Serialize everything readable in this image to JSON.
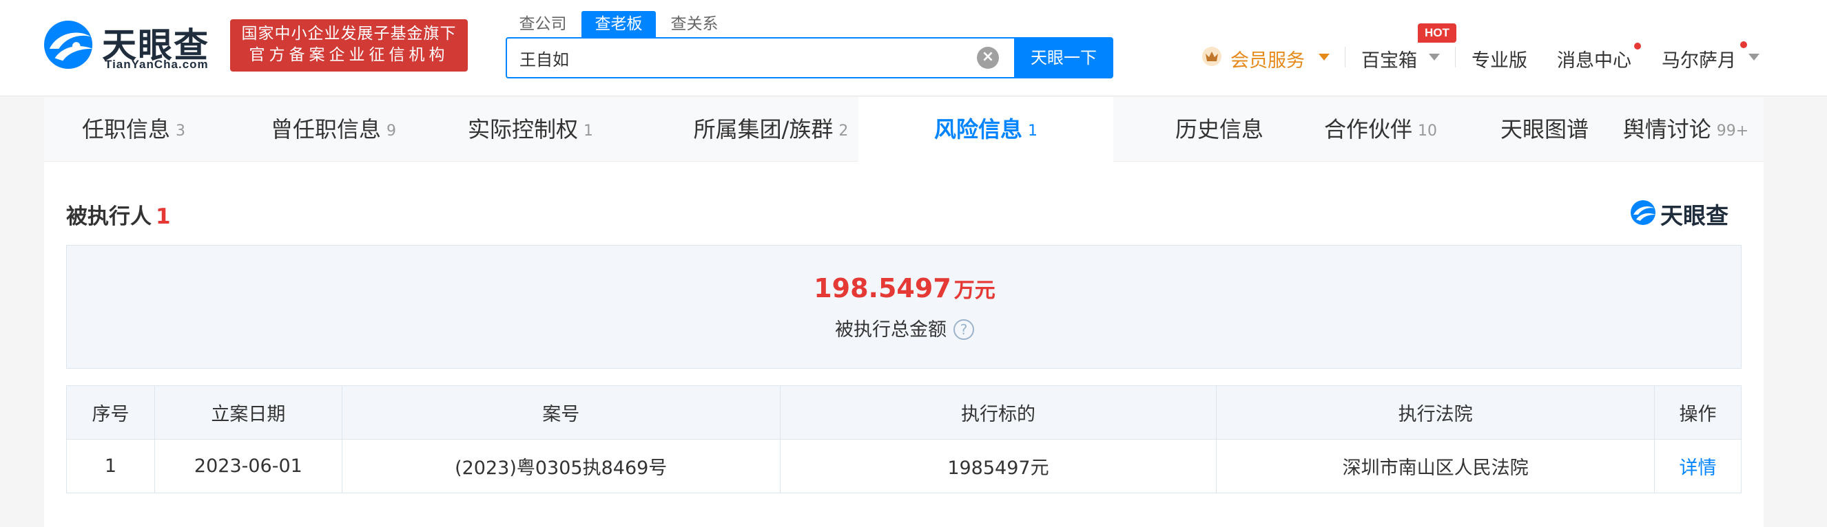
{
  "header": {
    "logo_text": "天眼查",
    "logo_sub": "TianYanCha.com",
    "badge_line1": "国家中小企业发展子基金旗下",
    "badge_line2": "官方备案企业征信机构",
    "search_tabs": [
      "查公司",
      "查老板",
      "查关系"
    ],
    "search_tab_active": 1,
    "search_value": "王自如",
    "search_button": "天眼一下",
    "vip_label": "会员服务",
    "baobao_label": "百宝箱",
    "hot_badge": "HOT",
    "pro_label": "专业版",
    "message_label": "消息中心",
    "user_name": "马尔萨月"
  },
  "tabs": [
    {
      "label": "任职信息",
      "count": "3"
    },
    {
      "label": "曾任职信息",
      "count": "9"
    },
    {
      "label": "实际控制权",
      "count": "1"
    },
    {
      "label": "所属集团/族群",
      "count": "2"
    },
    {
      "label": "风险信息",
      "count": "1"
    },
    {
      "label": "历史信息",
      "count": ""
    },
    {
      "label": "合作伙伴",
      "count": "10"
    },
    {
      "label": "天眼图谱",
      "count": ""
    },
    {
      "label": "舆情讨论",
      "count": "99+"
    }
  ],
  "active_tab": 4,
  "section": {
    "title": "被执行人",
    "count": "1",
    "brand": "天眼查"
  },
  "summary": {
    "amount": "198.5497",
    "unit": "万元",
    "label": "被执行总金额",
    "help": "?"
  },
  "table": {
    "headers": [
      "序号",
      "立案日期",
      "案号",
      "执行标的",
      "执行法院",
      "操作"
    ],
    "rows": [
      [
        "1",
        "2023-06-01",
        "(2023)粤0305执8469号",
        "1985497元",
        "深圳市南山区人民法院",
        "详情"
      ]
    ]
  },
  "colors": {
    "accent": "#0084ff",
    "danger": "#e53935",
    "vip": "#e58a1a"
  }
}
